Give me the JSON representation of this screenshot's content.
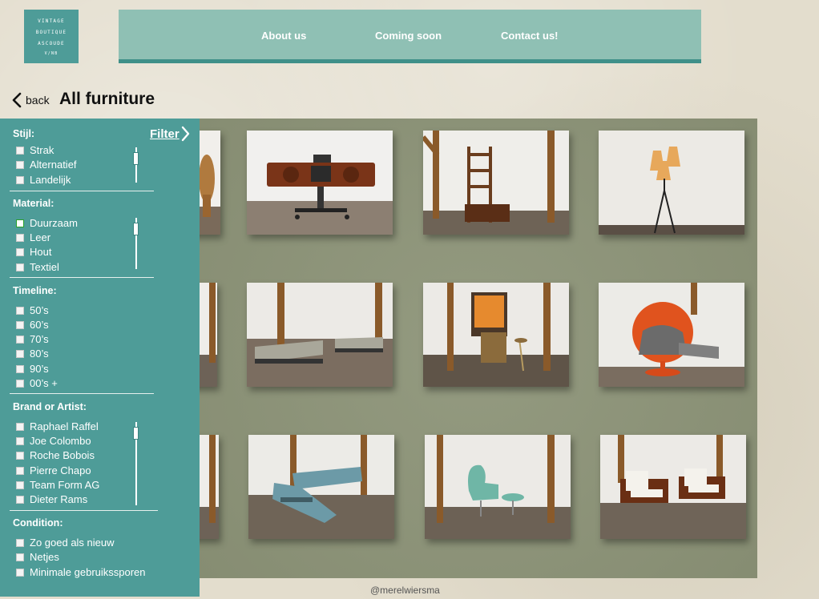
{
  "logo": {
    "line1": "VINTAGE",
    "line2": "BOUTIQUE",
    "line3": "ASCOUDE",
    "line4": "V/NB"
  },
  "nav": {
    "about": "About us",
    "coming": "Coming soon",
    "contact": "Contact us!"
  },
  "header": {
    "back_label": "back",
    "title": "All furniture"
  },
  "filter": {
    "label": "Filter",
    "groups": [
      {
        "title": "Stijl:",
        "options": [
          {
            "label": "Strak",
            "checked": false
          },
          {
            "label": "Alternatief",
            "checked": false
          },
          {
            "label": "Landelijk",
            "checked": false
          }
        ]
      },
      {
        "title": "Material:",
        "options": [
          {
            "label": "Duurzaam",
            "checked": true
          },
          {
            "label": "Leer",
            "checked": false
          },
          {
            "label": "Hout",
            "checked": false
          },
          {
            "label": "Textiel",
            "checked": false
          }
        ]
      },
      {
        "title": "Timeline:",
        "options": [
          {
            "label": "50’s",
            "checked": false
          },
          {
            "label": "60’s",
            "checked": false
          },
          {
            "label": "70’s",
            "checked": false
          },
          {
            "label": "80’s",
            "checked": false
          },
          {
            "label": "90’s",
            "checked": false
          },
          {
            "label": "00’s +",
            "checked": false
          }
        ]
      },
      {
        "title": "Brand or Artist:",
        "options": [
          {
            "label": "Raphael Raffel",
            "checked": false
          },
          {
            "label": "Joe Colombo",
            "checked": false
          },
          {
            "label": "Roche Bobois",
            "checked": false
          },
          {
            "label": "Pierre Chapo",
            "checked": false
          },
          {
            "label": "Team Form AG",
            "checked": false
          },
          {
            "label": "Dieter Rams",
            "checked": false
          }
        ]
      },
      {
        "title": "Condition:",
        "options": [
          {
            "label": "Zo goed als nieuw",
            "checked": false
          },
          {
            "label": "Netjes",
            "checked": false
          },
          {
            "label": "Minimale gebruikssporen",
            "checked": false
          }
        ]
      }
    ]
  },
  "gallery": {
    "items": [
      {
        "icon": "wicker-chair-image"
      },
      {
        "icon": "radio-console-image"
      },
      {
        "icon": "wooden-shelf-image"
      },
      {
        "icon": "floor-lamp-image"
      },
      {
        "icon": "partial-item-image"
      },
      {
        "icon": "modular-sofa-image"
      },
      {
        "icon": "bar-cabinet-image"
      },
      {
        "icon": "orange-pod-chair-image"
      },
      {
        "icon": "partial-item-image"
      },
      {
        "icon": "blue-sofa-image"
      },
      {
        "icon": "egg-chair-image"
      },
      {
        "icon": "lounge-chairs-image"
      }
    ]
  },
  "footer": {
    "credit": "@merelwiersma"
  },
  "colors": {
    "teal": "#4e9c98",
    "nav_bg": "#8fc0b4",
    "nav_border": "#3f9089",
    "gallery_bg": "#8d9478",
    "checked": "#2aa12a"
  }
}
